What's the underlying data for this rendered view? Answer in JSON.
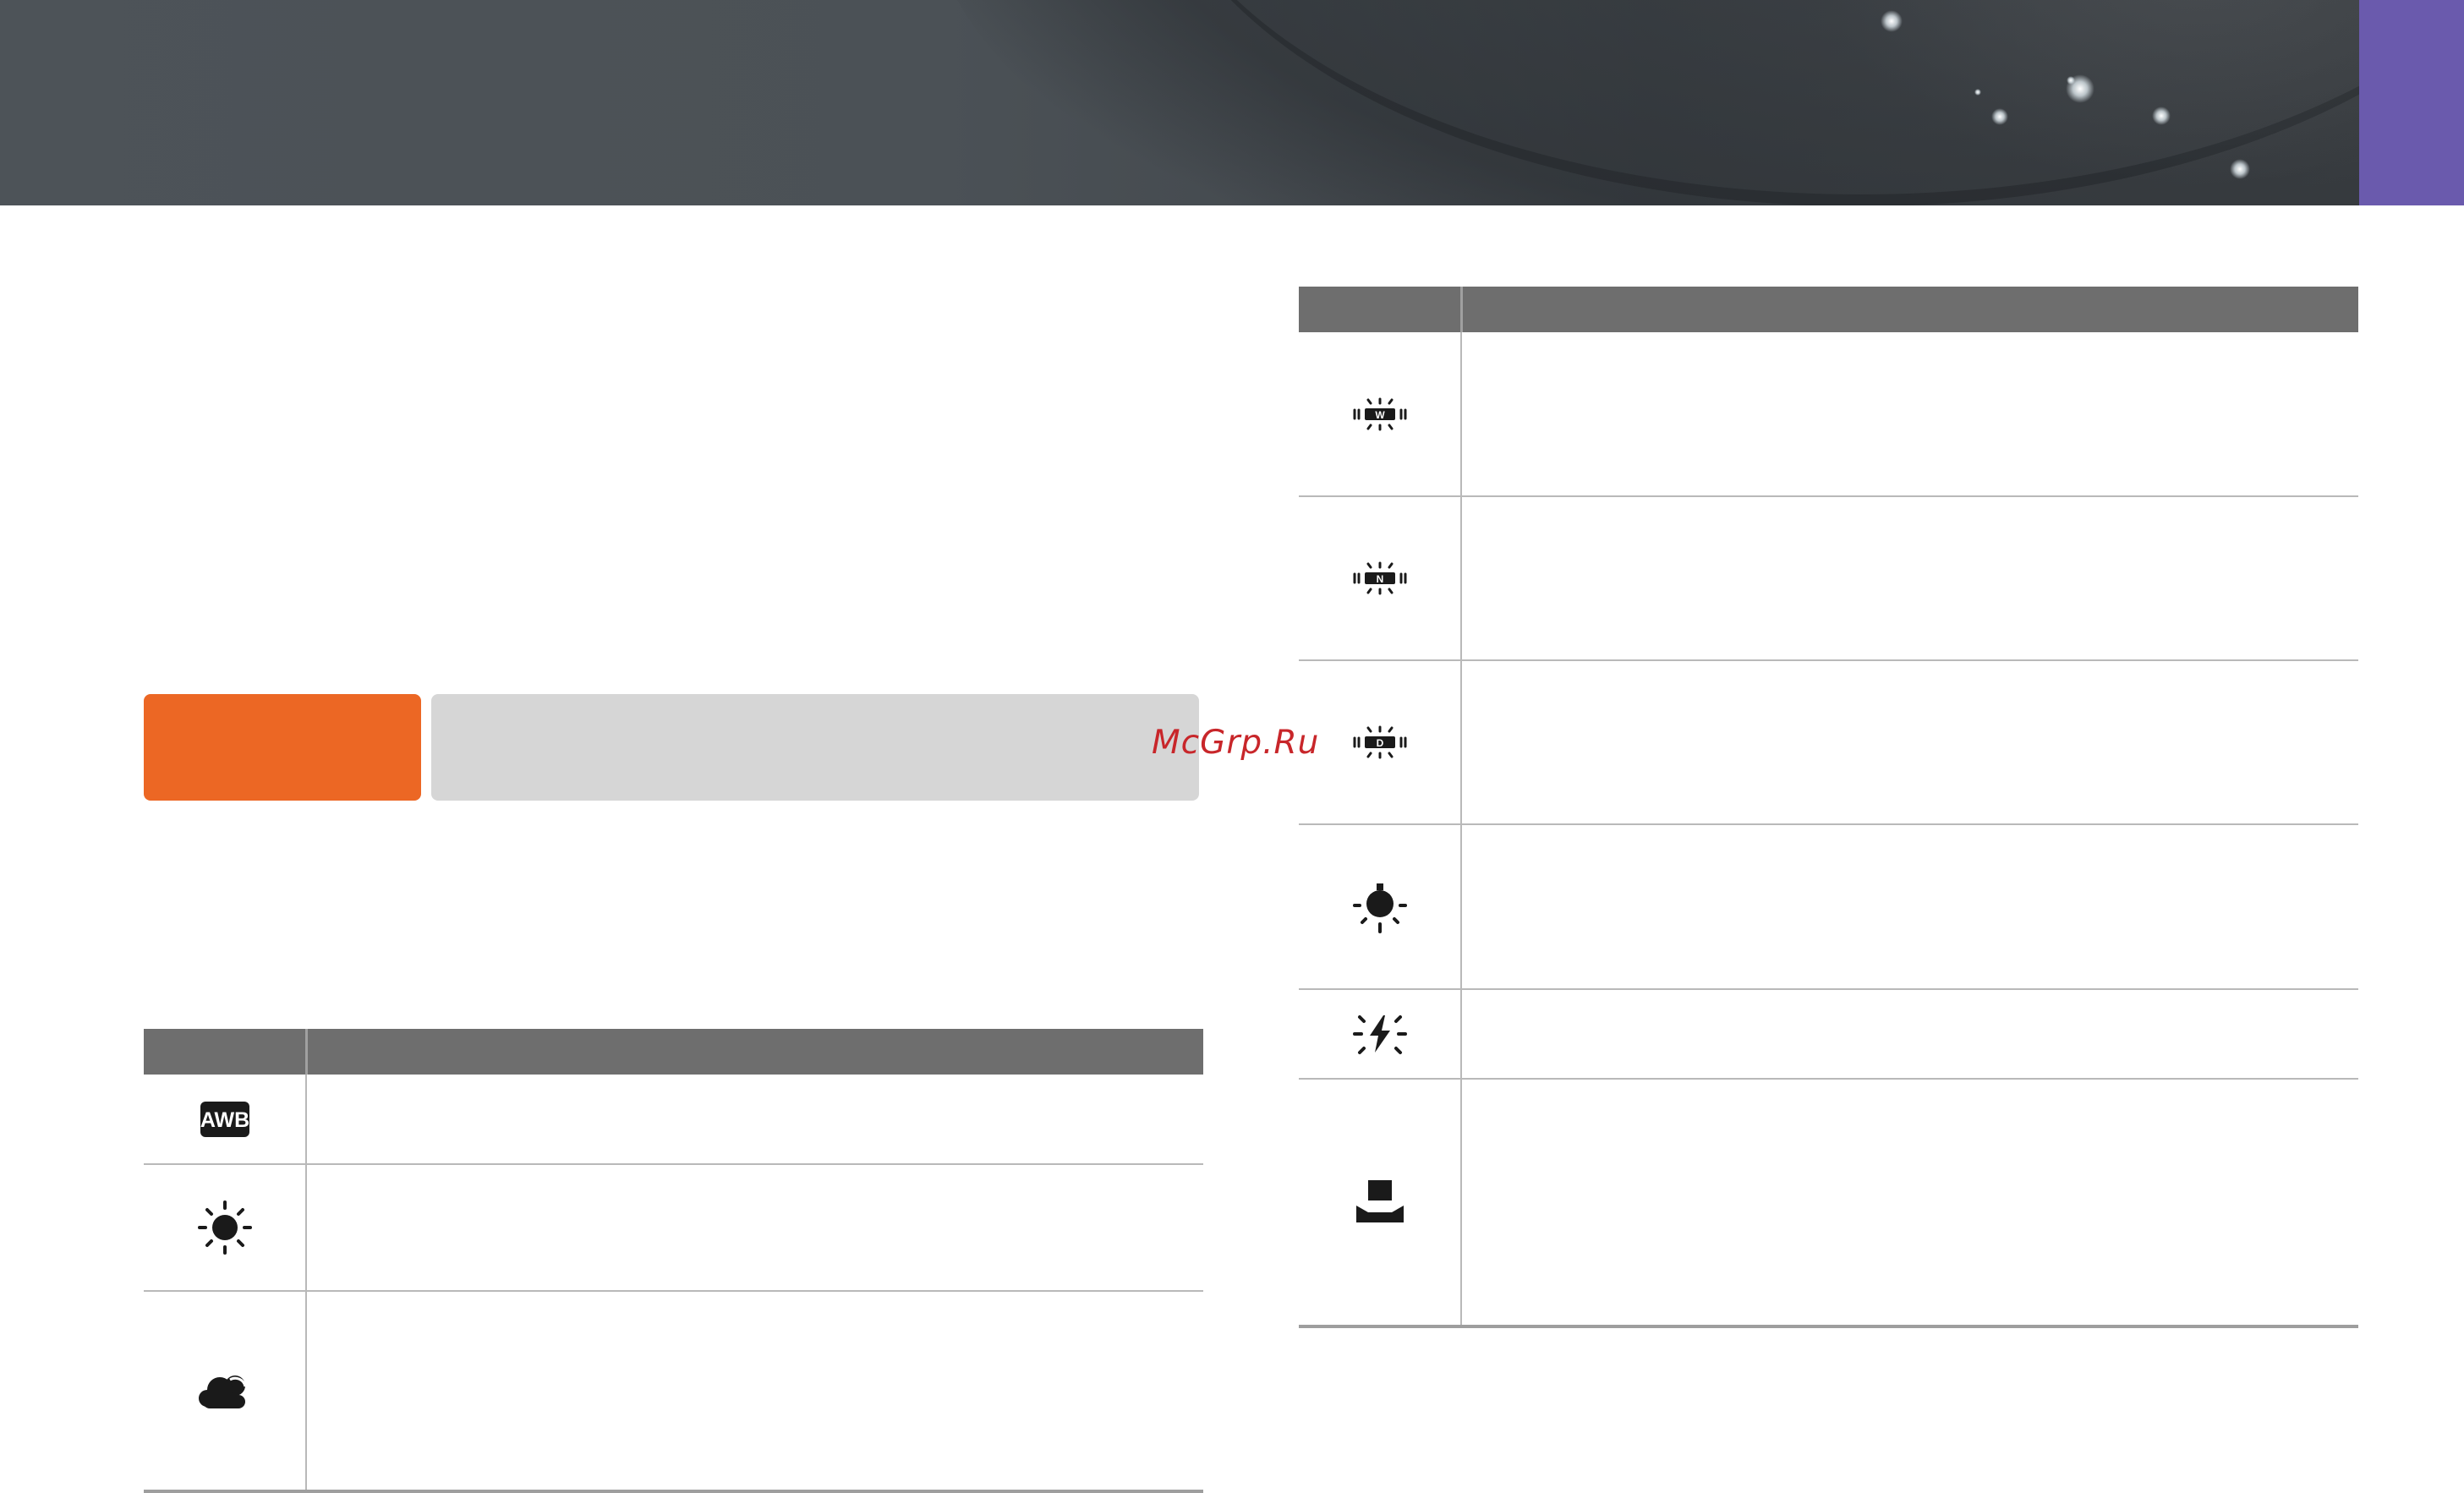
{
  "watermark": "McGrp.Ru",
  "left_table": {
    "rows": [
      {
        "icon": "awb-icon",
        "badge": "AWB"
      },
      {
        "icon": "daylight-sun-icon"
      },
      {
        "icon": "cloudy-icon"
      }
    ]
  },
  "right_table": {
    "rows": [
      {
        "icon": "fluorescent-w-icon",
        "badge": "W"
      },
      {
        "icon": "fluorescent-n-icon",
        "badge": "N"
      },
      {
        "icon": "fluorescent-d-icon",
        "badge": "D"
      },
      {
        "icon": "tungsten-bulb-icon"
      },
      {
        "icon": "flash-wb-icon"
      },
      {
        "icon": "custom-set-icon"
      }
    ]
  },
  "colors": {
    "banner": "#4b5156",
    "side_tab": "#6a5aad",
    "mode_orange": "#ec6724",
    "mode_gray": "#d6d6d6",
    "table_header": "#6e6e6e",
    "watermark": "#c8262a"
  }
}
